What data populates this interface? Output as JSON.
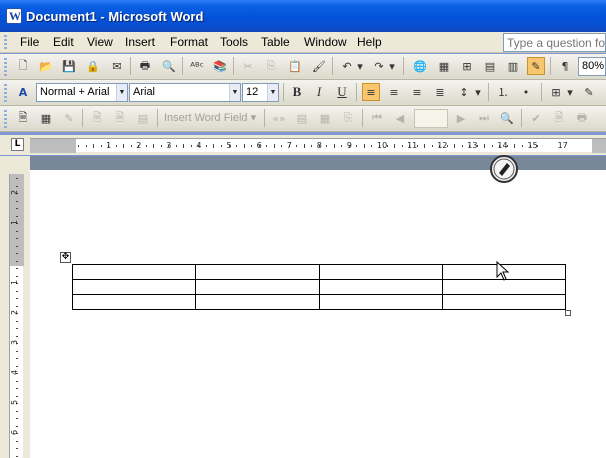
{
  "window": {
    "title": "Document1 - Microsoft Word"
  },
  "menu": {
    "items": [
      "File",
      "Edit",
      "View",
      "Insert",
      "Format",
      "Tools",
      "Table",
      "Window",
      "Help"
    ],
    "help_placeholder": "Type a question for"
  },
  "toolbar_standard": {
    "zoom": "80%"
  },
  "toolbar_formatting": {
    "style": "Normal + Arial",
    "font": "Arial",
    "size": "12"
  },
  "toolbar_mailmerge": {
    "insert_word_field": "Insert Word Field"
  },
  "ruler": {
    "horizontal_numbers": [
      "1",
      "2",
      "3",
      "4",
      "5",
      "6",
      "7",
      "8",
      "9",
      "10",
      "11",
      "12",
      "13",
      "14",
      "15",
      "17"
    ],
    "vertical_numbers": [
      "2",
      "1",
      "1",
      "2",
      "3",
      "4",
      "5",
      "6"
    ]
  },
  "table": {
    "rows": 3,
    "columns": 4
  }
}
